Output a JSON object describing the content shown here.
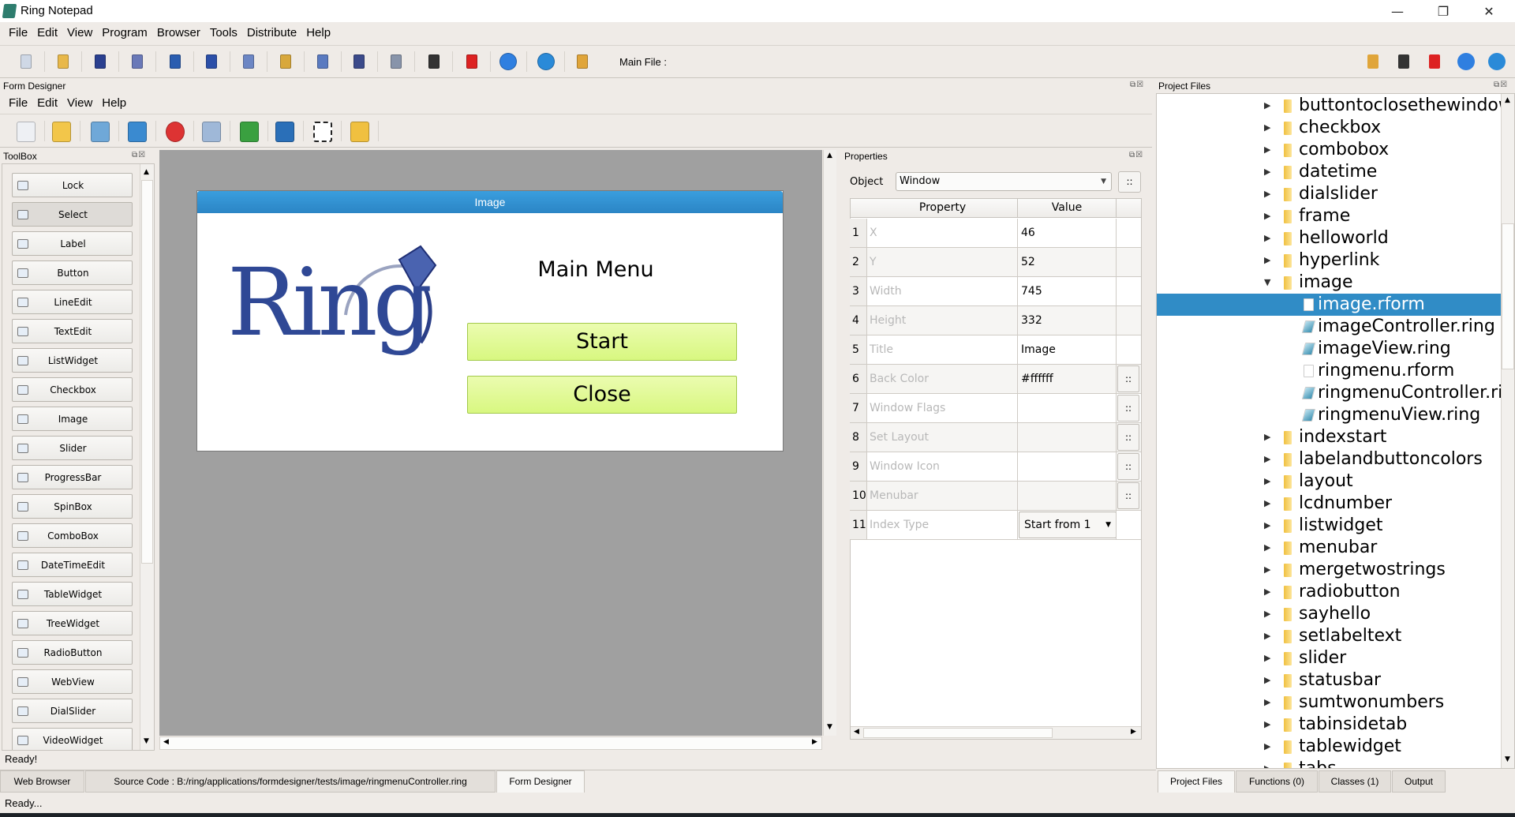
{
  "app": {
    "title": "Ring Notepad",
    "window_controls": [
      "minimize",
      "restore",
      "close"
    ]
  },
  "menubar": [
    "File",
    "Edit",
    "View",
    "Program",
    "Browser",
    "Tools",
    "Distribute",
    "Help"
  ],
  "main_toolbar": {
    "icons": [
      "new-file",
      "open-folder",
      "save",
      "save-as",
      "undo",
      "cut",
      "copy",
      "paste",
      "font",
      "pen",
      "print",
      "debug",
      "run-stop",
      "run",
      "web",
      "open-project"
    ],
    "main_file_label": "Main File :",
    "right_icons": [
      "open-project",
      "debug",
      "run-stop",
      "run",
      "web"
    ]
  },
  "form_designer": {
    "title": "Form Designer",
    "menu": [
      "File",
      "Edit",
      "View",
      "Help"
    ],
    "toolbar_icons": [
      "new",
      "open",
      "save",
      "save-as",
      "close",
      "duplicate",
      "bring-front",
      "delete",
      "select-objects",
      "open-rform"
    ]
  },
  "toolbox": {
    "title": "ToolBox",
    "items": [
      {
        "label": "Lock",
        "icon": "lock"
      },
      {
        "label": "Select",
        "icon": "cursor"
      },
      {
        "label": "Label",
        "icon": "label"
      },
      {
        "label": "Button",
        "icon": "button"
      },
      {
        "label": "LineEdit",
        "icon": "lineedit"
      },
      {
        "label": "TextEdit",
        "icon": "textedit"
      },
      {
        "label": "ListWidget",
        "icon": "list"
      },
      {
        "label": "Checkbox",
        "icon": "checkbox"
      },
      {
        "label": "Image",
        "icon": "image"
      },
      {
        "label": "Slider",
        "icon": "slider"
      },
      {
        "label": "ProgressBar",
        "icon": "progressbar"
      },
      {
        "label": "SpinBox",
        "icon": "spinbox"
      },
      {
        "label": "ComboBox",
        "icon": "combobox"
      },
      {
        "label": "DateTimeEdit",
        "icon": "calendar"
      },
      {
        "label": "TableWidget",
        "icon": "table"
      },
      {
        "label": "TreeWidget",
        "icon": "tree"
      },
      {
        "label": "RadioButton",
        "icon": "radio"
      },
      {
        "label": "WebView",
        "icon": "globe"
      },
      {
        "label": "DialSlider",
        "icon": "dial"
      },
      {
        "label": "VideoWidget",
        "icon": "video"
      }
    ]
  },
  "designed_form": {
    "title": "Image",
    "logo_text": "Ring",
    "heading": "Main Menu",
    "buttons": [
      "Start",
      "Close"
    ],
    "button_color": "#dcf88a",
    "title_color": "#2f8fd0"
  },
  "properties": {
    "title": "Properties",
    "object_label": "Object",
    "object_value": "Window",
    "more_label": "::",
    "headers": [
      "Property",
      "Value"
    ],
    "rows": [
      {
        "n": "1",
        "property": "X",
        "value": "46",
        "button": false
      },
      {
        "n": "2",
        "property": "Y",
        "value": "52",
        "button": false
      },
      {
        "n": "3",
        "property": "Width",
        "value": "745",
        "button": false
      },
      {
        "n": "4",
        "property": "Height",
        "value": "332",
        "button": false
      },
      {
        "n": "5",
        "property": "Title",
        "value": "Image",
        "button": false
      },
      {
        "n": "6",
        "property": "Back Color",
        "value": "#ffffff",
        "button": true
      },
      {
        "n": "7",
        "property": "Window Flags",
        "value": "",
        "button": true
      },
      {
        "n": "8",
        "property": "Set Layout",
        "value": "",
        "button": true
      },
      {
        "n": "9",
        "property": "Window Icon",
        "value": "",
        "button": true
      },
      {
        "n": "10",
        "property": "Menubar",
        "value": "",
        "button": true
      },
      {
        "n": "11",
        "property": "Index Type",
        "value": "Start from 1",
        "button": false,
        "select": true
      }
    ]
  },
  "project_files": {
    "title": "Project Files",
    "selected_color": "#308cc6",
    "items": [
      {
        "label": "buttontoclosethewindow",
        "type": "folder"
      },
      {
        "label": "checkbox",
        "type": "folder"
      },
      {
        "label": "combobox",
        "type": "folder"
      },
      {
        "label": "datetime",
        "type": "folder"
      },
      {
        "label": "dialslider",
        "type": "folder"
      },
      {
        "label": "frame",
        "type": "folder"
      },
      {
        "label": "helloworld",
        "type": "folder"
      },
      {
        "label": "hyperlink",
        "type": "folder"
      },
      {
        "label": "image",
        "type": "folder",
        "expanded": true
      },
      {
        "label": "image.rform",
        "type": "form",
        "child": true,
        "selected": true
      },
      {
        "label": "imageController.ring",
        "type": "ring",
        "child": true
      },
      {
        "label": "imageView.ring",
        "type": "ring",
        "child": true
      },
      {
        "label": "ringmenu.rform",
        "type": "form",
        "child": true
      },
      {
        "label": "ringmenuController.ri...",
        "type": "ring",
        "child": true
      },
      {
        "label": "ringmenuView.ring",
        "type": "ring",
        "child": true
      },
      {
        "label": "indexstart",
        "type": "folder"
      },
      {
        "label": "labelandbuttoncolors",
        "type": "folder"
      },
      {
        "label": "layout",
        "type": "folder"
      },
      {
        "label": "lcdnumber",
        "type": "folder"
      },
      {
        "label": "listwidget",
        "type": "folder"
      },
      {
        "label": "menubar",
        "type": "folder"
      },
      {
        "label": "mergetwostrings",
        "type": "folder"
      },
      {
        "label": "radiobutton",
        "type": "folder"
      },
      {
        "label": "sayhello",
        "type": "folder"
      },
      {
        "label": "setlabeltext",
        "type": "folder"
      },
      {
        "label": "slider",
        "type": "folder"
      },
      {
        "label": "statusbar",
        "type": "folder"
      },
      {
        "label": "sumtwonumbers",
        "type": "folder"
      },
      {
        "label": "tabinsidetab",
        "type": "folder"
      },
      {
        "label": "tablewidget",
        "type": "folder"
      },
      {
        "label": "tabs",
        "type": "folder"
      }
    ]
  },
  "status": {
    "designer": "Ready!",
    "main": "Ready..."
  },
  "bottom_tabs": [
    "Web Browser",
    "Source Code : B:/ring/applications/formdesigner/tests/image/ringmenuController.ring",
    "Form Designer"
  ],
  "right_tabs": [
    "Project Files",
    "Functions (0)",
    "Classes (1)",
    "Output"
  ]
}
